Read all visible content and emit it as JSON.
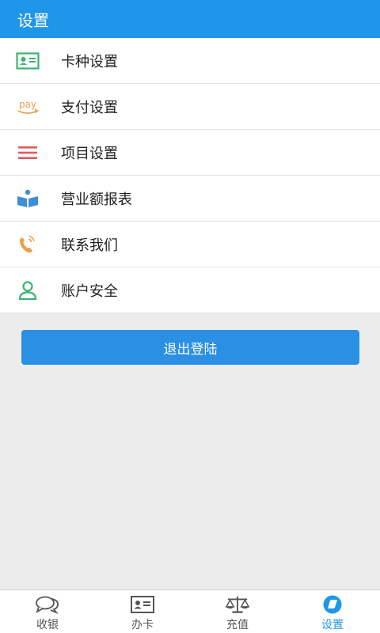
{
  "header": {
    "title": "设置"
  },
  "menu": {
    "items": [
      {
        "label": "卡种设置",
        "icon": "id-card-icon"
      },
      {
        "label": "支付设置",
        "icon": "pay-icon",
        "icon_text": "pay"
      },
      {
        "label": "项目设置",
        "icon": "list-icon"
      },
      {
        "label": "营业额报表",
        "icon": "book-icon"
      },
      {
        "label": "联系我们",
        "icon": "phone-icon"
      },
      {
        "label": "账户安全",
        "icon": "user-icon"
      }
    ]
  },
  "logout": {
    "label": "退出登陆"
  },
  "tabbar": {
    "tabs": [
      {
        "label": "收银",
        "icon": "chat-icon",
        "active": false
      },
      {
        "label": "办卡",
        "icon": "card-icon",
        "active": false
      },
      {
        "label": "充值",
        "icon": "scale-icon",
        "active": false
      },
      {
        "label": "设置",
        "icon": "settings-icon",
        "active": true
      }
    ]
  },
  "colors": {
    "header_bg": "#1f96e8",
    "button_bg": "#2b8fe3",
    "active_tab": "#1f96e8",
    "green": "#3cb371",
    "orange": "#e8a04a",
    "red": "#e05a5a",
    "blue": "#3d8fd6"
  }
}
